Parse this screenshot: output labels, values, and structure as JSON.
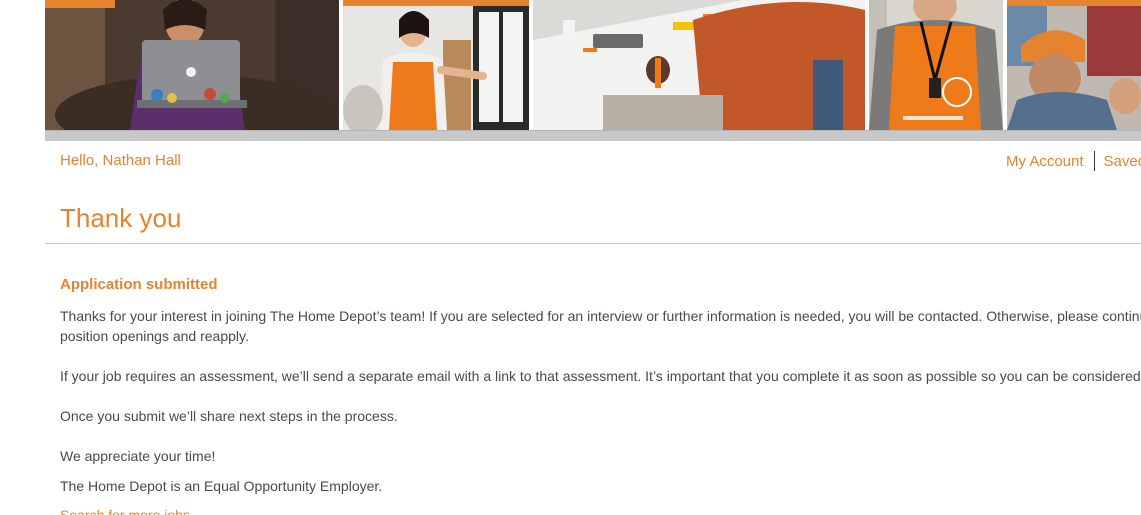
{
  "user_bar": {
    "greeting": "Hello, Nathan Hall",
    "my_account_label": "My Account",
    "saved_label": "Saved"
  },
  "page": {
    "title": "Thank you",
    "subheading": "Application submitted",
    "paragraph_1_line_1": "Thanks for your interest in joining The Home Depot’s team! If you are selected for an interview or further information is needed, you will be contacted. Otherwise, please continue to review position openings and reapply.",
    "paragraph_1_line_2": "position openings and reapply.",
    "paragraph_2": "If your job requires an assessment, we’ll send a separate email with a link to that assessment. It’s important that you complete it as soon as possible so you can be considered for the position.",
    "paragraph_3": "Once you submit we’ll share next steps in the process.",
    "paragraph_4": "We appreciate your time!",
    "paragraph_5": "The Home Depot is an Equal Opportunity Employer.",
    "search_link": "Search for more jobs"
  },
  "banner": {
    "photos": [
      "person-with-laptop-photo",
      "associate-presenting-photo",
      "meeting-table-photo",
      "associate-apron-photo",
      "crowd-photo"
    ]
  },
  "colors": {
    "brand_orange": "#e5832e",
    "body_text": "#4a4a4a",
    "rule": "#c9c9c9"
  }
}
